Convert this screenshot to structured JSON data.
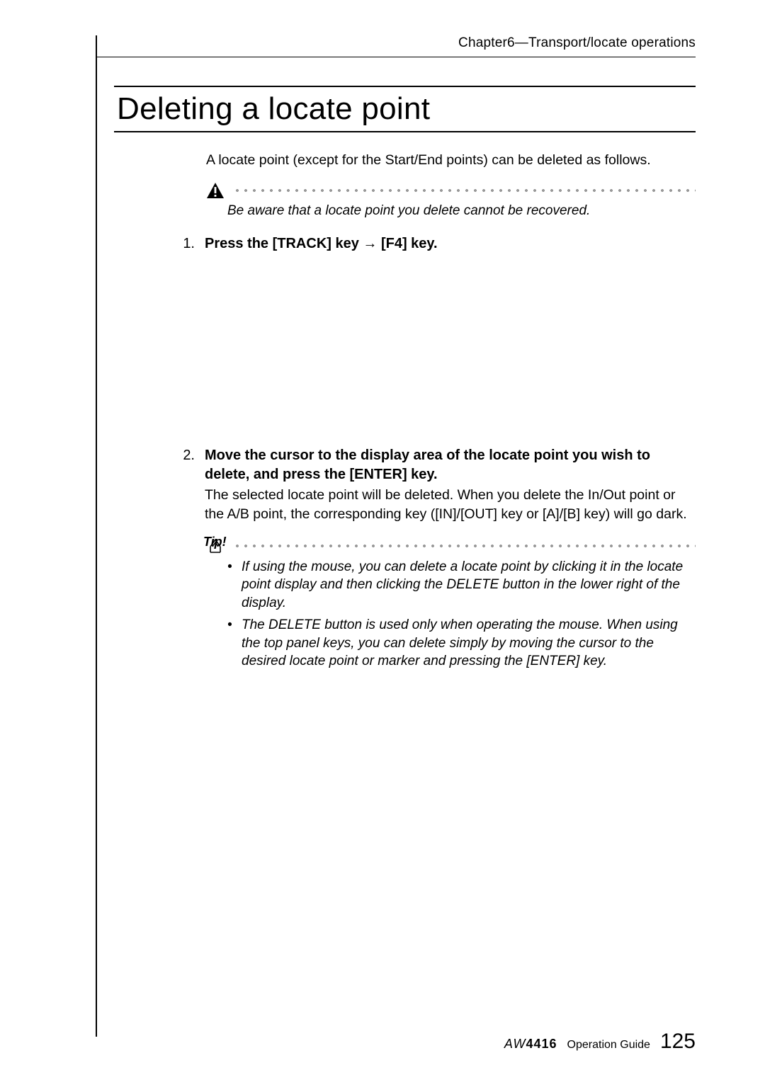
{
  "header": {
    "chapter": "Chapter6—Transport/locate operations"
  },
  "title": "Deleting a locate point",
  "intro": "A locate point (except for the Start/End points) can be deleted as follows.",
  "warning": {
    "text": "Be aware that a locate point you delete cannot be recovered."
  },
  "steps": [
    {
      "num": "1.",
      "bold": "Press the [TRACK] key → [F4] key.",
      "sub": ""
    },
    {
      "num": "2.",
      "bold": "Move the cursor to the display area of the locate point you wish to delete, and press the [ENTER] key.",
      "sub": "The selected locate point will be deleted. When you delete the In/Out point or the A/B point, the corresponding key ([IN]/[OUT] key or [A]/[B] key) will go dark."
    }
  ],
  "tip": {
    "label": "Tip!",
    "items": [
      "If using the mouse, you can delete a locate point by clicking it in the locate point display and then clicking the DELETE button in the lower right of the display.",
      "The DELETE button is used only when operating the mouse. When using the top panel keys, you can delete simply by moving the cursor to the desired locate point or marker and pressing the [ENTER] key."
    ]
  },
  "footer": {
    "product_prefix": "AW",
    "product_model": "4416",
    "guide": "Operation Guide",
    "page": "125"
  }
}
